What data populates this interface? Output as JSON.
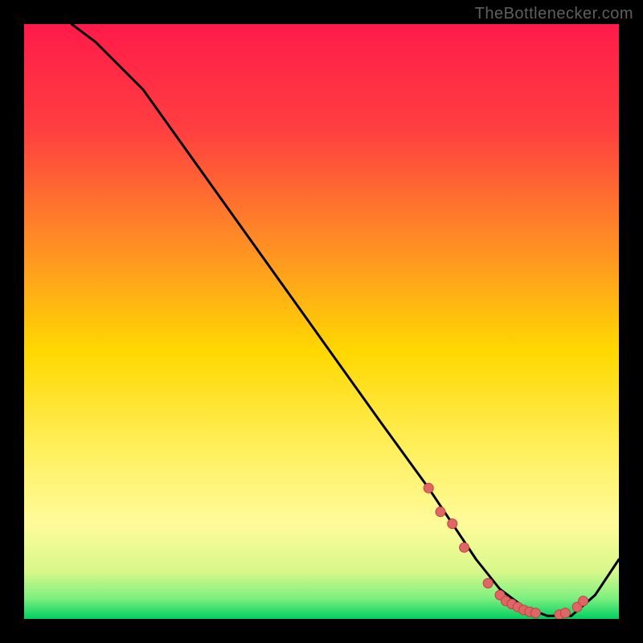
{
  "watermark": "TheBottlenecker.com",
  "chart_data": {
    "type": "line",
    "title": "",
    "xlabel": "",
    "ylabel": "",
    "xlim": [
      0,
      100
    ],
    "ylim": [
      0,
      100
    ],
    "grid": false,
    "legend": false,
    "background_gradient": [
      "#ff1a4a",
      "#ffd800",
      "#fffb9a",
      "#00e060"
    ],
    "series": [
      {
        "name": "curve",
        "color": "#000000",
        "x": [
          8,
          12,
          16,
          20,
          30,
          40,
          50,
          60,
          68,
          72,
          76,
          80,
          84,
          88,
          92,
          96,
          100
        ],
        "y": [
          100,
          97,
          93,
          89,
          75,
          61,
          47,
          33,
          22,
          16,
          10,
          5,
          2,
          0.5,
          0.5,
          4,
          10
        ]
      }
    ],
    "markers": {
      "color": "#e06666",
      "stroke": "#c04040",
      "points_x": [
        68,
        70,
        72,
        74,
        78,
        80,
        81,
        82,
        83,
        84,
        85,
        86,
        90,
        91,
        93,
        94
      ],
      "points_y": [
        22,
        18,
        16,
        12,
        6,
        4,
        3,
        2.5,
        2,
        1.5,
        1.2,
        1,
        0.7,
        1,
        2,
        3
      ]
    }
  }
}
